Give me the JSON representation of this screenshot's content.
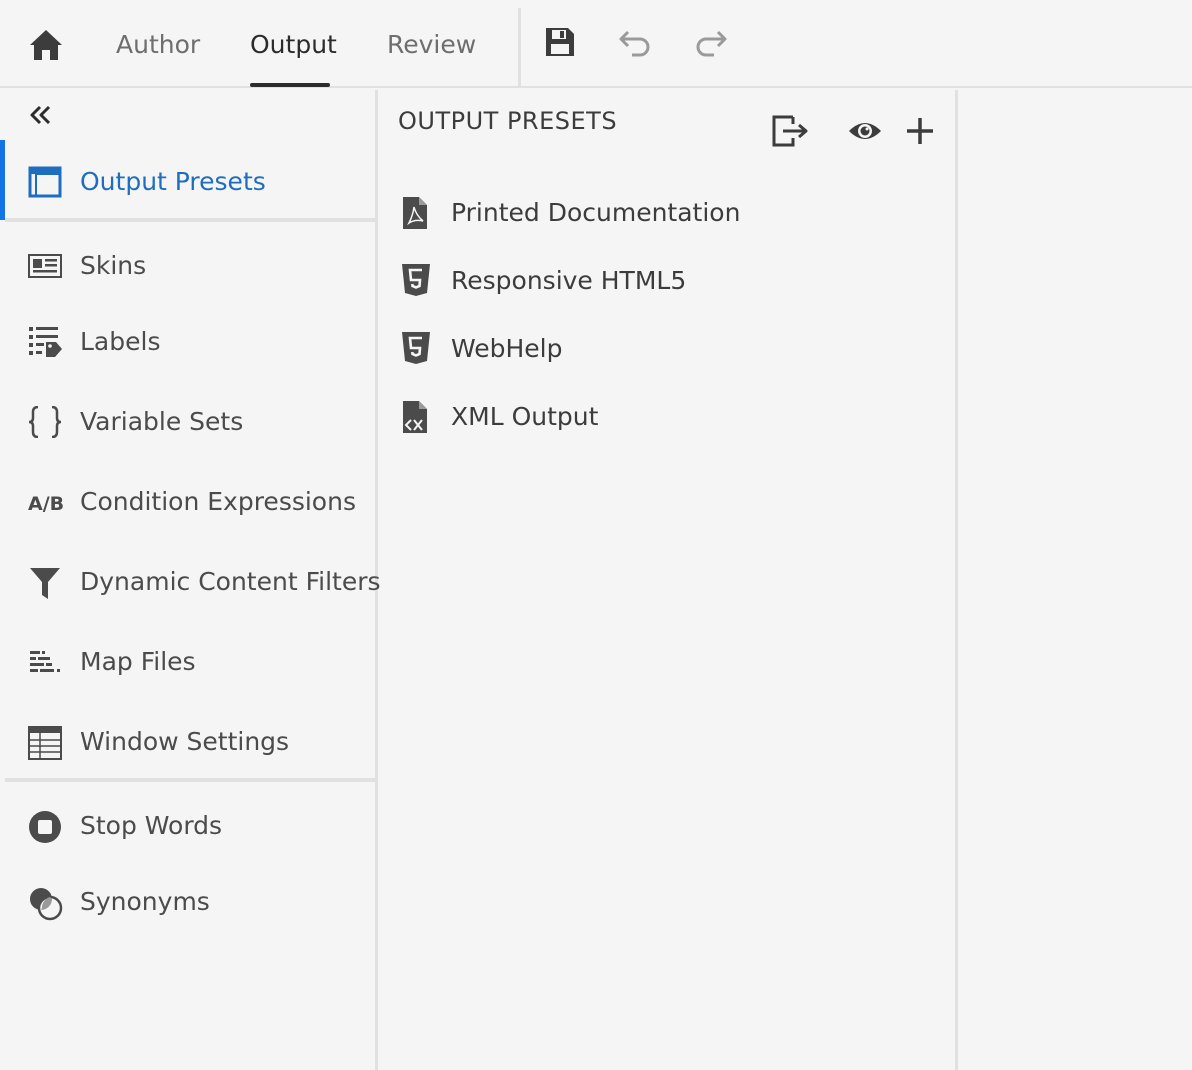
{
  "topbar": {
    "tabs": [
      {
        "label": "Author"
      },
      {
        "label": "Output"
      },
      {
        "label": "Review"
      }
    ],
    "active_tab": "Output",
    "tools": [
      "save-icon",
      "undo-icon",
      "redo-icon"
    ]
  },
  "sidebar": {
    "items": [
      {
        "label": "Output Presets",
        "icon": "output-presets-icon"
      },
      {
        "label": "Skins",
        "icon": "skins-icon"
      },
      {
        "label": "Labels",
        "icon": "labels-icon"
      },
      {
        "label": "Variable Sets",
        "icon": "braces-icon"
      },
      {
        "label": "Condition Expressions",
        "icon": "ab-icon"
      },
      {
        "label": "Dynamic Content Filters",
        "icon": "funnel-icon"
      },
      {
        "label": "Map Files",
        "icon": "map-files-icon"
      },
      {
        "label": "Window Settings",
        "icon": "table-icon"
      },
      {
        "label": "Stop Words",
        "icon": "stop-icon"
      },
      {
        "label": "Synonyms",
        "icon": "synonyms-icon"
      }
    ],
    "active_item": "Output Presets"
  },
  "panel": {
    "title": "OUTPUT PRESETS",
    "presets": [
      {
        "label": "Printed Documentation",
        "icon": "pdf-file-icon"
      },
      {
        "label": "Responsive HTML5",
        "icon": "html5-icon"
      },
      {
        "label": "WebHelp",
        "icon": "html5-icon"
      },
      {
        "label": "XML Output",
        "icon": "xml-file-icon"
      }
    ]
  },
  "colors": {
    "accent": "#1473e6",
    "active_text": "#1f6dbe",
    "icon": "#4b4b4b",
    "background": "#f5f5f5",
    "divider": "#e1e1e1"
  }
}
